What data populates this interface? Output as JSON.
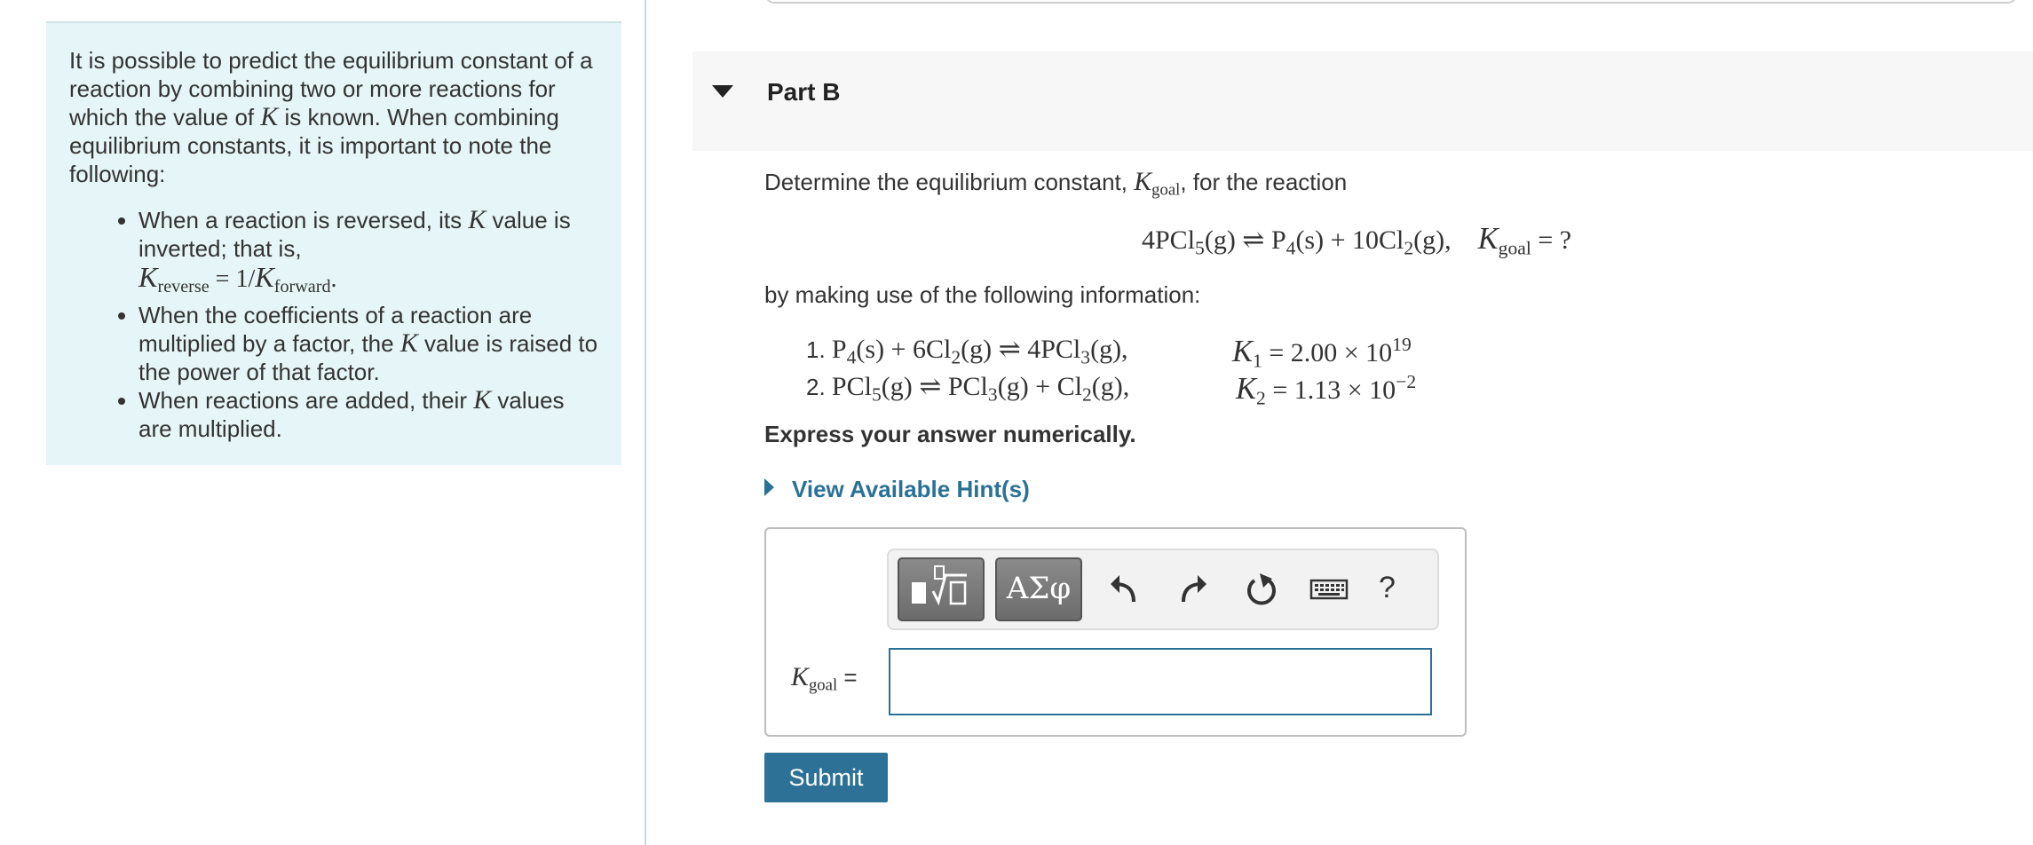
{
  "info": {
    "intro_1": "It is possible to predict the equilibrium constant of a reaction by combining two or more reactions for which the value of ",
    "intro_var": "K",
    "intro_2": " is known. When combining equilibrium constants, it is important to note the following:",
    "bullet1_a": "When a reaction is reversed, its ",
    "bullet1_b": " value is inverted; that is,",
    "bullet1_formula_lhs": "reverse",
    "bullet1_formula_rhs": "forward",
    "bullet2_a": "When the coefficients of a reaction are multiplied by a factor, the ",
    "bullet2_b": " value is raised to the power of that factor.",
    "bullet3_a": "When reactions are added, their ",
    "bullet3_b": " values are multiplied."
  },
  "part": {
    "title": "Part B"
  },
  "question": {
    "prompt_a": "Determine the equilibrium constant, ",
    "prompt_sub": "goal",
    "prompt_b": ", for the reaction",
    "info_intro": "by making use of the following information:",
    "instruction": "Express your answer numerically.",
    "k1_value": "2.00 × 10",
    "k1_exp": "19",
    "k2_value": "1.13 × 10",
    "k2_exp": "−2"
  },
  "hints": {
    "label": "View Available Hint(s)"
  },
  "answer": {
    "label_sub": "goal",
    "label_eq": " =",
    "value": ""
  },
  "toolbar": {
    "symbols_label": "ΑΣφ",
    "help_label": "?"
  },
  "submit": {
    "label": "Submit"
  },
  "colors": {
    "accent": "#2d7196",
    "panel_bg": "#e6f5f7",
    "header_bg": "#f7f7f7"
  }
}
